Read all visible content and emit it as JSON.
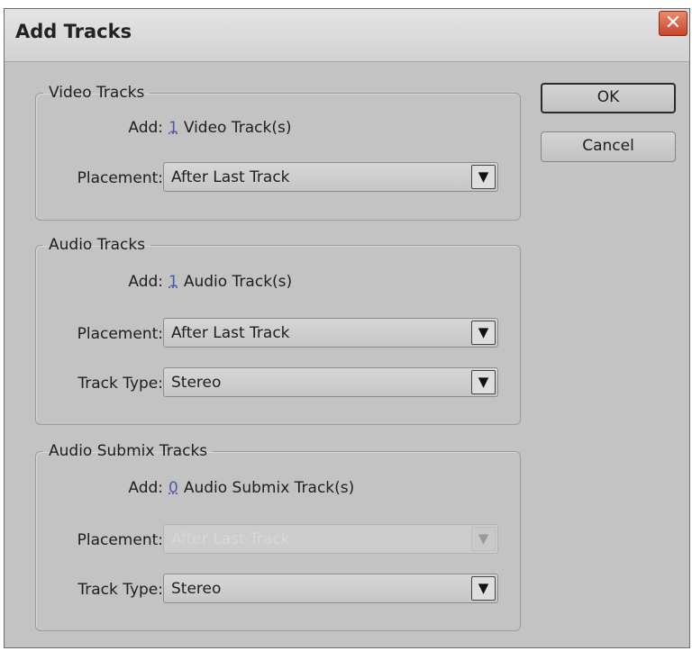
{
  "window": {
    "title": "Add Tracks",
    "close_glyph": "✕"
  },
  "buttons": {
    "ok": "OK",
    "cancel": "Cancel"
  },
  "video": {
    "legend": "Video Tracks",
    "add_label": "Add:",
    "count": "1",
    "suffix": "Video Track(s)",
    "placement_label": "Placement:",
    "placement_value": "After Last Track"
  },
  "audio": {
    "legend": "Audio Tracks",
    "add_label": "Add:",
    "count": "1",
    "suffix": "Audio Track(s)",
    "placement_label": "Placement:",
    "placement_value": "After Last Track",
    "type_label": "Track Type:",
    "type_value": "Stereo"
  },
  "submix": {
    "legend": "Audio Submix Tracks",
    "add_label": "Add:",
    "count": "0",
    "suffix": "Audio Submix Track(s)",
    "placement_label": "Placement:",
    "placement_value": "After Last Track",
    "type_label": "Track Type:",
    "type_value": "Stereo"
  },
  "icons": {
    "dropdown": "▼"
  }
}
